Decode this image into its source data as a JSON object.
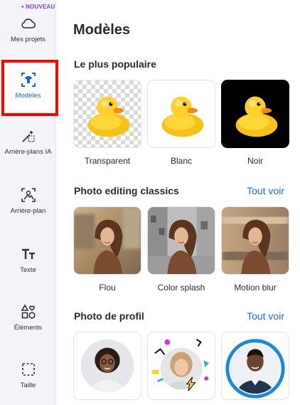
{
  "sidebar": {
    "badge": "NOUVEAU",
    "items": [
      {
        "label": "Mes projets",
        "icon": "cloud-icon"
      },
      {
        "label": "Modèles",
        "icon": "template-icon",
        "active": true
      },
      {
        "label": "Arrière-plans IA",
        "icon": "magic-wand-icon"
      },
      {
        "label": "Arrière-plan",
        "icon": "background-icon"
      },
      {
        "label": "Texte",
        "icon": "text-icon"
      },
      {
        "label": "Éléments",
        "icon": "shapes-icon"
      },
      {
        "label": "Taille",
        "icon": "resize-icon"
      }
    ]
  },
  "main": {
    "title": "Modèles",
    "sections": [
      {
        "title": "Le plus populaire",
        "items": [
          {
            "label": "Transparent"
          },
          {
            "label": "Blanc"
          },
          {
            "label": "Noir"
          }
        ]
      },
      {
        "title": "Photo editing classics",
        "see_all": "Tout voir",
        "items": [
          {
            "label": "Flou"
          },
          {
            "label": "Color splash"
          },
          {
            "label": "Motion blur"
          }
        ]
      },
      {
        "title": "Photo de profil",
        "see_all": "Tout voir"
      }
    ]
  },
  "colors": {
    "accent": "#1d6be0",
    "badge": "#7b3fe4",
    "highlight": "#ff0000"
  }
}
